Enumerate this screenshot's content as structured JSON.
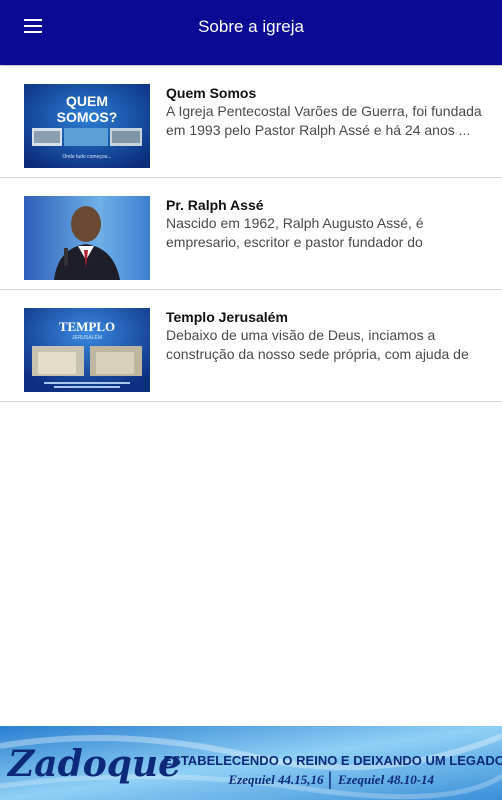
{
  "header": {
    "title": "Sobre a igreja",
    "menu_icon": "hamburger-menu-icon",
    "background": "#0a0a94"
  },
  "items": [
    {
      "title": "Quem Somos",
      "description": "A Igreja Pentecostal Varões de Guerra, foi fundada em 1993 pelo Pastor Ralph Assé e há 24 anos ...",
      "thumb_text": "QUEM SOMOS?",
      "thumb_caption": "Onde tudo começou..."
    },
    {
      "title": "Pr. Ralph Assé",
      "description": "Nascido em 1962, Ralph Augusto Assé, é empresario,  escritor e pastor fundador do"
    },
    {
      "title": "Templo Jerusalém",
      "description": "Debaixo de uma visão de Deus, inciamos a construção da nosso sede própria, com ajuda de",
      "thumb_text": "TEMPLO",
      "thumb_subtext": "JERUSALÉM"
    }
  ],
  "banner": {
    "brand": "Zadoque",
    "slogan": "ESTABELECENDO O REINO E DEIXANDO UM LEGADO.",
    "ref1": "Ezequiel 44.15,16",
    "ref2": "Ezequiel 48.10-14"
  }
}
